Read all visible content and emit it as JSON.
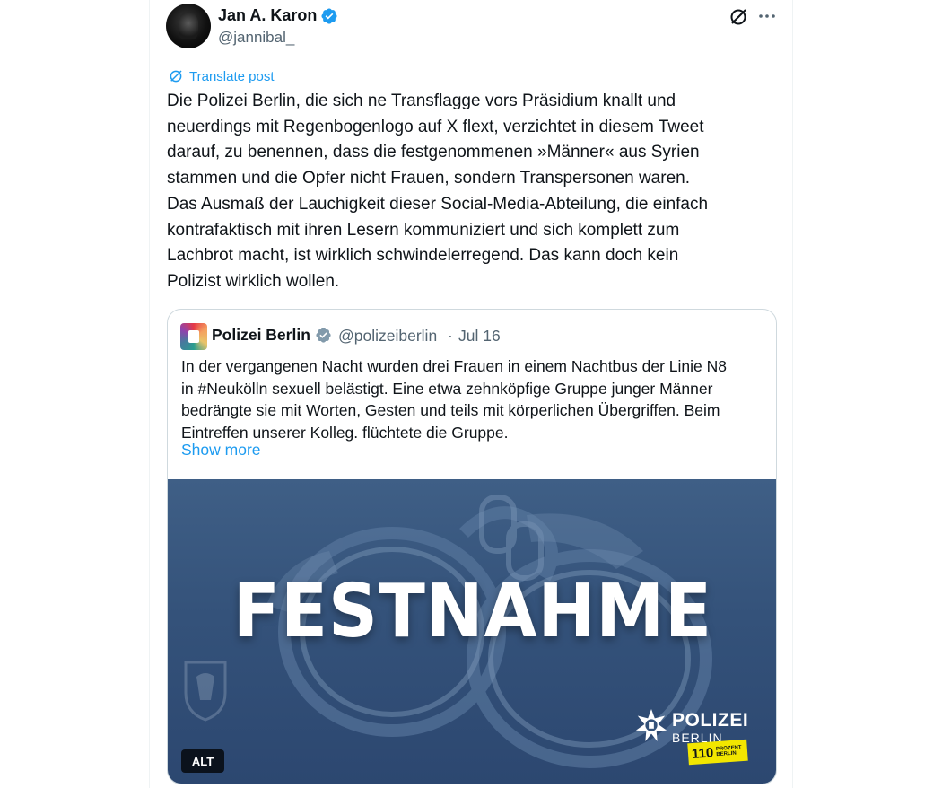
{
  "author": {
    "name": "Jan A. Karon",
    "handle": "@jannibal_",
    "verified": true
  },
  "actions": {
    "grok_icon": "grok-slash-circle-icon",
    "more_icon": "more-horizontal-icon"
  },
  "translate_label": "Translate post",
  "tweet_text": "Die Polizei Berlin, die sich ne Transflagge vors Präsidium knallt und\nneuerdings mit Regenbogenlogo auf X flext, verzichtet in diesem Tweet\ndarauf, zu benennen, dass die festgenommenen »Männer« aus Syrien\nstammen und die Opfer nicht Frauen, sondern Transpersonen waren.\nDas Ausmaß der Lauchigkeit dieser Social-Media-Abteilung, die einfach\nkontrafaktisch mit ihren Lesern kommuniziert und sich komplett zum\nLachbrot macht, ist wirklich schwindelerregend. Das kann doch kein\nPolizist wirklich wollen.",
  "quoted": {
    "name": "Polizei Berlin",
    "handle": "@polizeiberlin",
    "separator": "·",
    "date": "Jul 16",
    "text": "In der vergangenen Nacht wurden drei Frauen in einem Nachtbus der Linie N8\nin #Neukölln sexuell belästigt. Eine etwa zehnköpfige Gruppe junger Männer\nbedrängte sie mit Worten, Gesten und teils mit körperlichen Übergriffen. Beim\nEintreffen unserer Kolleg. flüchtete die Gruppe.",
    "show_more": "Show more",
    "media": {
      "headline": "FESTNAHME",
      "logo_word": "POLIZEI",
      "logo_city": "BERLIN",
      "tag_number": "110",
      "tag_small": "PROZENT BERLIN",
      "alt_label": "ALT"
    }
  },
  "colors": {
    "link": "#1d9bf0",
    "secondary_text": "#536471",
    "verified_badge": "#1d9bf0",
    "media_bg": "#34527a",
    "tag_yellow": "#f2e600"
  }
}
